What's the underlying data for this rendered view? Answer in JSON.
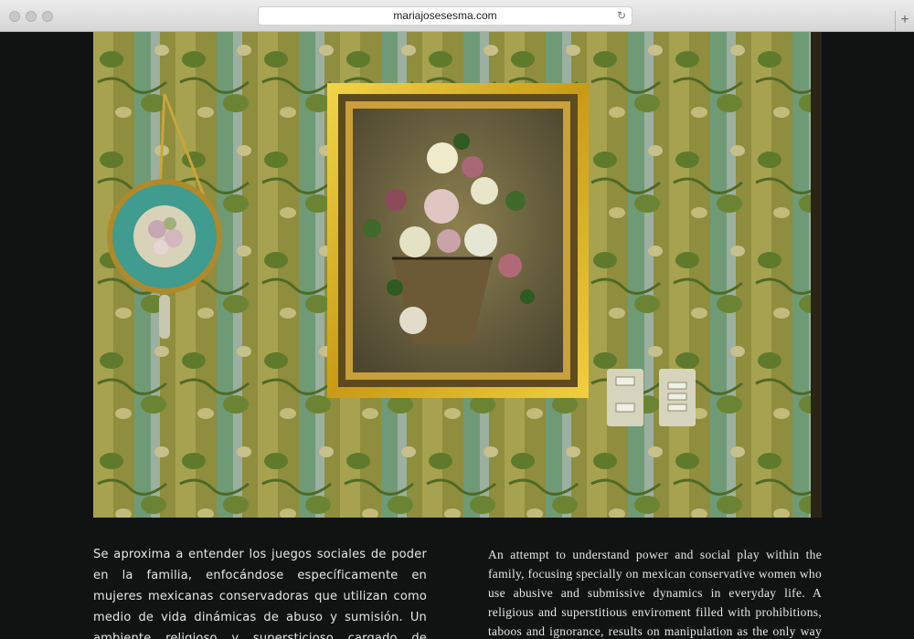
{
  "browser": {
    "url": "mariajosesesma.com",
    "reload_icon": "reload-icon",
    "new_tab_icon": "plus-icon"
  },
  "content": {
    "text_es": "Se aproxima a entender los juegos sociales de poder en la familia, enfocándose específicamente en mujeres mexicanas conservadoras que utilizan como medio de vida dinámicas de abuso y sumisión. Un ambiente religioso y supersticioso cargado de prohibiciones, tabúes e ignorancia, facilitan la",
    "text_en": "An attempt to understand power and social play within the family, focusing specially on mexican conservative women who use abusive and submissive dynamics in everyday life. A religious and superstitious enviroment filled with prohibitions, taboos and ignorance, results on manipulation as the only way to interact."
  }
}
